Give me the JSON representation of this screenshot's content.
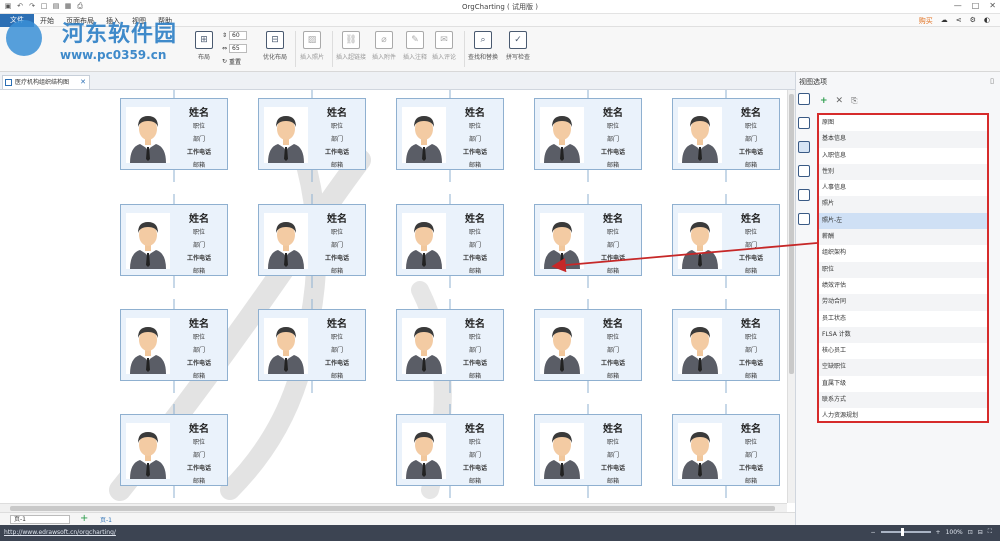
{
  "window": {
    "title": "OrgCharting ( 试用版 )"
  },
  "watermark": {
    "title": "河东软件园",
    "url": "www.pc0359.cn"
  },
  "menu": {
    "file": "文件",
    "items": [
      "开始",
      "页面布局",
      "插入",
      "视图",
      "帮助"
    ],
    "buy": "购买"
  },
  "ribbon": {
    "layout_label": "布局",
    "reset_label": "重置",
    "spin1": "60",
    "spin2": "65",
    "optimize_label": "优化布局",
    "insert_picture": "插入照片",
    "insert_hyperlink": "插入超链接",
    "insert_attachment": "插入附件",
    "insert_note": "插入注释",
    "insert_comment": "插入评论",
    "find_replace": "查找和替换",
    "spellcheck": "拼写检查"
  },
  "tab": {
    "label": "医疗机构组织结构图"
  },
  "card": {
    "name": "姓名",
    "position": "职位",
    "department": "部门",
    "phone": "工作电话",
    "email": "邮箱"
  },
  "rows": [
    {
      "count": 5,
      "y": 0
    },
    {
      "count": 5,
      "y": 1
    },
    {
      "count": 5,
      "y": 2
    },
    {
      "count": 4,
      "y": 3
    }
  ],
  "pagebar": {
    "page_select": "页-1",
    "current_page": "页-1"
  },
  "status": {
    "url": "http://www.edrawsoft.cn/orgcharting/",
    "zoom": "100%"
  },
  "panel": {
    "title": "视图选项",
    "items": [
      "原图",
      "基本信息",
      "入职信息",
      "性别",
      "人事信息",
      "照片",
      "照片-左",
      "薪酬",
      "组织架构",
      "职位",
      "绩效评估",
      "劳动合同",
      "员工状态",
      "FLSA 计数",
      "核心员工",
      "空缺职位",
      "直属下级",
      "联系方式",
      "人力资源规划"
    ],
    "selected_index": 6
  },
  "colors": {
    "accent": "#2c6fb4",
    "highlight_border": "#d62b2b",
    "card_bg": "#eaf2fb",
    "card_border": "#8fb0d0"
  }
}
